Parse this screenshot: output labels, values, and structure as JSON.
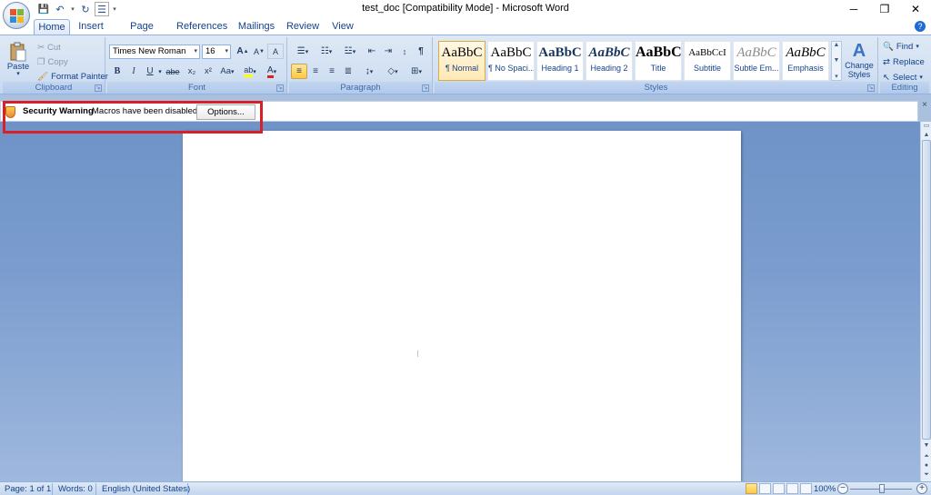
{
  "window": {
    "title": "test_doc [Compatibility Mode] - Microsoft Word",
    "minimize": "─",
    "restore": "❐",
    "close": "✕"
  },
  "qat": {
    "save_icon": "💾",
    "undo_icon": "↶",
    "redo_icon": "↻",
    "misc_icon": "☰",
    "customize": "▾"
  },
  "tabs": [
    "Home",
    "Insert",
    "Page Layout",
    "References",
    "Mailings",
    "Review",
    "View"
  ],
  "help": "?",
  "clipboard": {
    "paste": "Paste",
    "paste_drop": "▾",
    "cut": "Cut",
    "copy": "Copy",
    "format_painter": "Format Painter",
    "label": "Clipboard"
  },
  "font": {
    "family": "Times New Roman",
    "size": "16",
    "grow": "A",
    "shrink": "A",
    "clear": "A",
    "bold": "B",
    "italic": "I",
    "underline": "U",
    "strike": "abe",
    "subscript": "x₂",
    "superscript": "x²",
    "change_case": "Aa",
    "highlight": "ab",
    "font_color": "A",
    "label": "Font"
  },
  "paragraph": {
    "pilcrow": "¶",
    "label": "Paragraph"
  },
  "styles": {
    "items": [
      {
        "sample": "AaBbC",
        "name": "¶ Normal"
      },
      {
        "sample": "AaBbC",
        "name": "¶ No Spaci..."
      },
      {
        "sample": "AaBbC",
        "name": "Heading 1"
      },
      {
        "sample": "AaBbC",
        "name": "Heading 2"
      },
      {
        "sample": "AaBbC",
        "name": "Title"
      },
      {
        "sample": "AaBbCcI",
        "name": "Subtitle"
      },
      {
        "sample": "AaBbC",
        "name": "Subtle Em..."
      },
      {
        "sample": "AaBbC",
        "name": "Emphasis"
      }
    ],
    "change_styles_line1": "Change",
    "change_styles_line2": "Styles",
    "label": "Styles"
  },
  "editing": {
    "find": "Find",
    "replace": "Replace",
    "select": "Select",
    "label": "Editing"
  },
  "message_bar": {
    "title": "Security Warning",
    "text": "Macros have been disabled.",
    "button": "Options...",
    "close": "×"
  },
  "status": {
    "page": "Page: 1 of 1",
    "words": "Words: 0",
    "language": "English (United States)",
    "zoom": "100%",
    "zoom_out": "−",
    "zoom_in": "+"
  },
  "colors": {
    "accent": "#15428b",
    "highlight_box": "#d72027",
    "ribbon_bg": "#d3e1f3"
  }
}
